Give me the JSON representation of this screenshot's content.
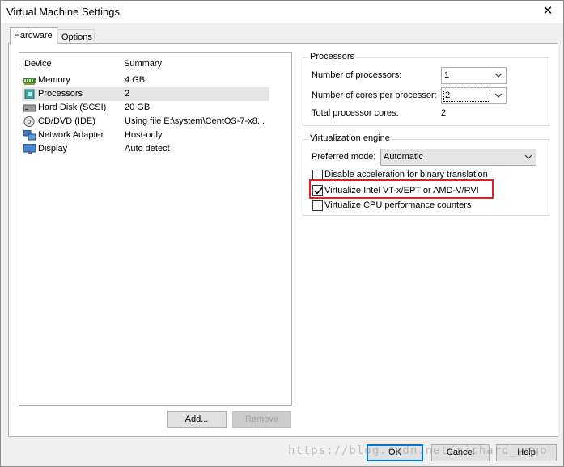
{
  "window": {
    "title": "Virtual Machine Settings",
    "close_glyph": "✕"
  },
  "tabs": [
    {
      "label": "Hardware"
    },
    {
      "label": "Options"
    }
  ],
  "device_list": {
    "col_device": "Device",
    "col_summary": "Summary",
    "rows": [
      {
        "device": "Memory",
        "summary": "4 GB",
        "icon": "memory-icon"
      },
      {
        "device": "Processors",
        "summary": "2",
        "icon": "processor-icon"
      },
      {
        "device": "Hard Disk (SCSI)",
        "summary": "20 GB",
        "icon": "hard-disk-icon"
      },
      {
        "device": "CD/DVD (IDE)",
        "summary": "Using file E:\\system\\CentOS-7-x8...",
        "icon": "cd-dvd-icon"
      },
      {
        "device": "Network Adapter",
        "summary": "Host-only",
        "icon": "network-adapter-icon"
      },
      {
        "device": "Display",
        "summary": "Auto detect",
        "icon": "display-icon"
      }
    ],
    "selected": "Processors"
  },
  "buttons": {
    "add": "Add...",
    "remove": "Remove",
    "ok": "OK",
    "cancel": "Cancel",
    "help": "Help"
  },
  "processors": {
    "title": "Processors",
    "num_processors_label": "Number of processors:",
    "num_processors_value": "1",
    "cores_label": "Number of cores per processor:",
    "cores_value": "2",
    "total_label": "Total processor cores:",
    "total_value": "2"
  },
  "virtualization": {
    "title": "Virtualization engine",
    "mode_label": "Preferred mode:",
    "mode_value": "Automatic",
    "options": [
      {
        "label": "Disable acceleration for binary translation",
        "checked": false
      },
      {
        "label": "Virtualize Intel VT-x/EPT or AMD-V/RVI",
        "checked": true
      },
      {
        "label": "Virtualize CPU performance counters",
        "checked": false
      }
    ]
  },
  "watermark": "https://blog.csdn.net/richard_yogo",
  "colors": {
    "highlight": "#e02020",
    "focus": "#0078d7",
    "selected_row": "#e5e5e5"
  }
}
